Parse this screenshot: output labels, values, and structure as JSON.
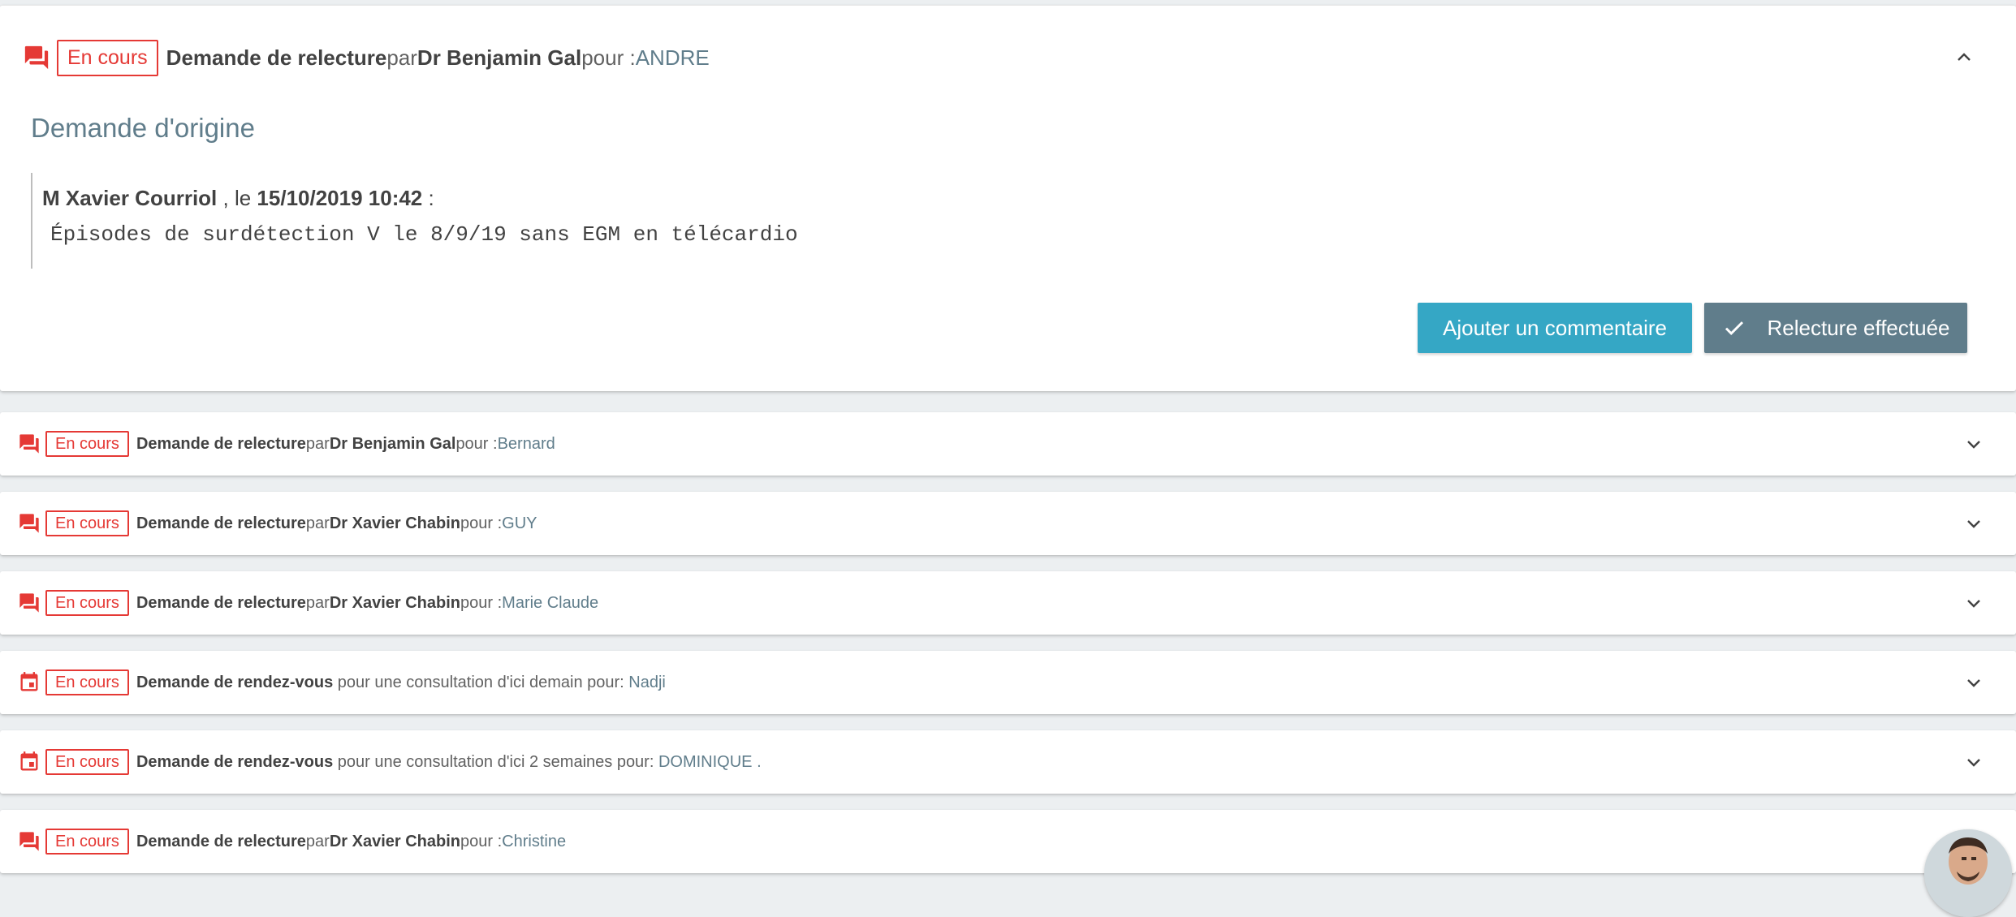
{
  "colors": {
    "status_red": "#e53935",
    "patient_blue_grey": "#607d8b",
    "comment_button": "#35a7c5",
    "done_button": "#607d8b",
    "background": "#eceff1"
  },
  "expanded": {
    "icon": "message-icon",
    "status": "En cours",
    "title": "Demande de relecture",
    "par": "par",
    "doctor": "Dr Benjamin Gal",
    "pour": "pour :",
    "patient": "ANDRE",
    "origin_title": "Demande d'origine",
    "author": "M Xavier Courriol",
    "le": " , le ",
    "date": "15/10/2019 10:42",
    "colon": " :",
    "message": "Épisodes de surdétection V le 8/9/19 sans EGM en télécardio",
    "comment_button": "Ajouter un commentaire",
    "done_button": "Relecture effectuée"
  },
  "items": [
    {
      "icon": "message-icon",
      "status": "En cours",
      "title": "Demande de relecture",
      "par": "par",
      "doctor": "Dr Benjamin Gal",
      "pour": "pour :",
      "patient": "Bernard"
    },
    {
      "icon": "message-icon",
      "status": "En cours",
      "title": "Demande de relecture",
      "par": "par",
      "doctor": "Dr Xavier Chabin",
      "pour": "pour :",
      "patient": "GUY"
    },
    {
      "icon": "message-icon",
      "status": "En cours",
      "title": "Demande de relecture",
      "par": "par",
      "doctor": "Dr Xavier Chabin",
      "pour": "pour :",
      "patient": "Marie Claude"
    },
    {
      "icon": "calendar-icon",
      "status": "En cours",
      "title": "Demande de rendez-vous",
      "detail": " pour une consultation d'ici demain pour: ",
      "patient": "Nadji"
    },
    {
      "icon": "calendar-icon",
      "status": "En cours",
      "title": "Demande de rendez-vous",
      "detail": " pour une consultation d'ici 2 semaines pour: ",
      "patient": "DOMINIQUE ."
    },
    {
      "icon": "message-icon",
      "status": "En cours",
      "title": "Demande de relecture",
      "par": "par",
      "doctor": "Dr Xavier Chabin",
      "pour": "pour :",
      "patient": "Christine"
    }
  ]
}
